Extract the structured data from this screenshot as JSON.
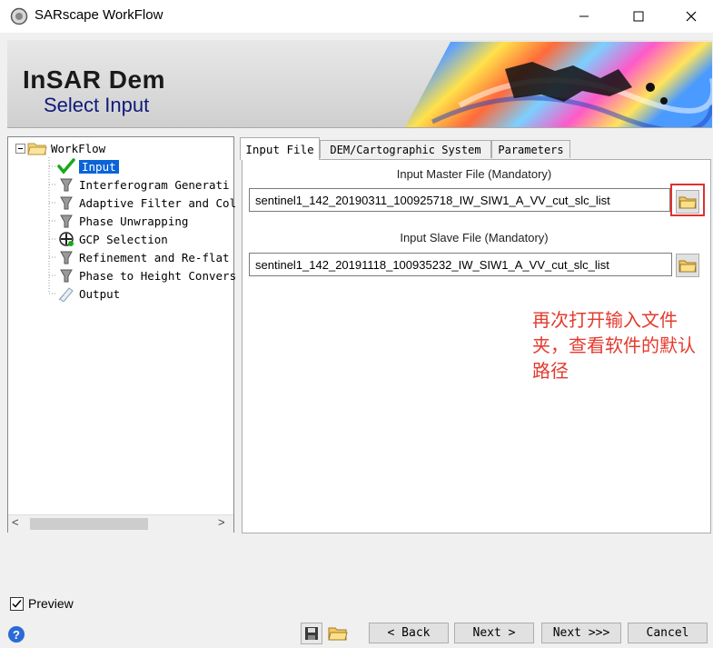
{
  "window": {
    "title": "SARscape WorkFlow",
    "controls": {
      "minimize": "—",
      "maximize": "☐",
      "close": "✕"
    }
  },
  "banner": {
    "title": "InSAR Dem",
    "subtitle": "Select Input"
  },
  "tree": {
    "root": "WorkFlow",
    "items": [
      {
        "label": "Input",
        "icon": "checkmark-icon",
        "selected": true
      },
      {
        "label": "Interferogram Generati",
        "icon": "funnel-icon"
      },
      {
        "label": "Adaptive Filter and Col",
        "icon": "funnel-icon"
      },
      {
        "label": "Phase Unwrapping",
        "icon": "funnel-icon"
      },
      {
        "label": "GCP Selection",
        "icon": "gcp-crosshair-icon"
      },
      {
        "label": "Refinement and Re-flat",
        "icon": "funnel-icon"
      },
      {
        "label": "Phase to Height Convers",
        "icon": "funnel-icon"
      },
      {
        "label": "Output",
        "icon": "output-icon"
      }
    ],
    "scroll_left": "<",
    "scroll_right": ">"
  },
  "tabs": [
    {
      "label": "Input File",
      "active": true
    },
    {
      "label": "DEM/Cartographic System"
    },
    {
      "label": "Parameters"
    }
  ],
  "input": {
    "master_label": "Input Master File (Mandatory)",
    "master_value": "sentinel1_142_20190311_100925718_IW_SIW1_A_VV_cut_slc_list",
    "slave_label": "Input Slave File (Mandatory)",
    "slave_value": "sentinel1_142_20191118_100935232_IW_SIW1_A_VV_cut_slc_list"
  },
  "annotation": "再次打开输入文件夹，查看软件的默认路径",
  "preview": {
    "label": "Preview",
    "checked": true
  },
  "buttons": {
    "back": "< Back",
    "next": "Next >",
    "next_all": "Next >>>",
    "cancel": "Cancel"
  },
  "colors": {
    "accent": "#0a64d8",
    "annotation": "#e33b2e",
    "highlight_box": "#e03030"
  }
}
